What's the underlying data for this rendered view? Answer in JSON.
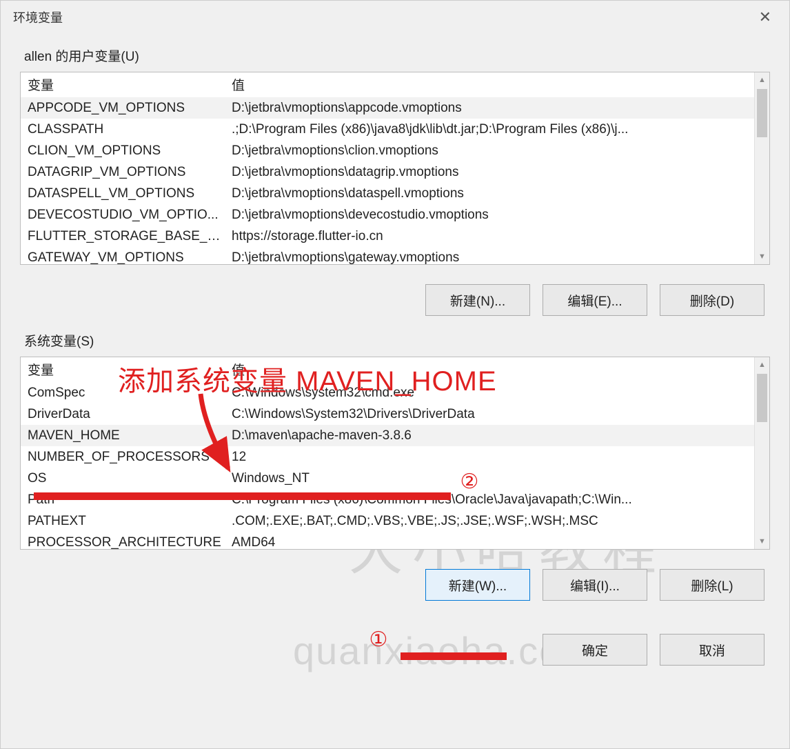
{
  "window": {
    "title": "环境变量"
  },
  "user_section": {
    "label": "allen 的用户变量(U)",
    "header_var": "变量",
    "header_val": "值",
    "rows": [
      {
        "name": "APPCODE_VM_OPTIONS",
        "value": "D:\\jetbra\\vmoptions\\appcode.vmoptions",
        "selected": true
      },
      {
        "name": "CLASSPATH",
        "value": ".;D:\\Program Files (x86)\\java8\\jdk\\lib\\dt.jar;D:\\Program Files (x86)\\j..."
      },
      {
        "name": "CLION_VM_OPTIONS",
        "value": "D:\\jetbra\\vmoptions\\clion.vmoptions"
      },
      {
        "name": "DATAGRIP_VM_OPTIONS",
        "value": "D:\\jetbra\\vmoptions\\datagrip.vmoptions"
      },
      {
        "name": "DATASPELL_VM_OPTIONS",
        "value": "D:\\jetbra\\vmoptions\\dataspell.vmoptions"
      },
      {
        "name": "DEVECOSTUDIO_VM_OPTIO...",
        "value": "D:\\jetbra\\vmoptions\\devecostudio.vmoptions"
      },
      {
        "name": "FLUTTER_STORAGE_BASE_URL",
        "value": "https://storage.flutter-io.cn"
      },
      {
        "name": "GATEWAY_VM_OPTIONS",
        "value": "D:\\jetbra\\vmoptions\\gateway.vmoptions"
      }
    ],
    "buttons": {
      "new": "新建(N)...",
      "edit": "编辑(E)...",
      "delete": "删除(D)"
    }
  },
  "system_section": {
    "label": "系统变量(S)",
    "header_var": "变量",
    "header_val": "值",
    "rows": [
      {
        "name": "ComSpec",
        "value": "C:\\Windows\\system32\\cmd.exe"
      },
      {
        "name": "DriverData",
        "value": "C:\\Windows\\System32\\Drivers\\DriverData"
      },
      {
        "name": "MAVEN_HOME",
        "value": "D:\\maven\\apache-maven-3.8.6",
        "selected": true
      },
      {
        "name": "NUMBER_OF_PROCESSORS",
        "value": "12"
      },
      {
        "name": "OS",
        "value": "Windows_NT"
      },
      {
        "name": "Path",
        "value": "C:\\Program Files (x86)\\Common Files\\Oracle\\Java\\javapath;C:\\Win..."
      },
      {
        "name": "PATHEXT",
        "value": ".COM;.EXE;.BAT;.CMD;.VBS;.VBE;.JS;.JSE;.WSF;.WSH;.MSC"
      },
      {
        "name": "PROCESSOR_ARCHITECTURE",
        "value": "AMD64"
      }
    ],
    "buttons": {
      "new": "新建(W)...",
      "edit": "编辑(I)...",
      "delete": "删除(L)"
    }
  },
  "dialog_buttons": {
    "ok": "确定",
    "cancel": "取消"
  },
  "annotations": {
    "title": "添加系统变量 MAVEN_HOME",
    "marker1": "①",
    "marker2": "②"
  },
  "watermark": {
    "big": "犬小哈教程",
    "url": "quanxiaoha.com"
  }
}
